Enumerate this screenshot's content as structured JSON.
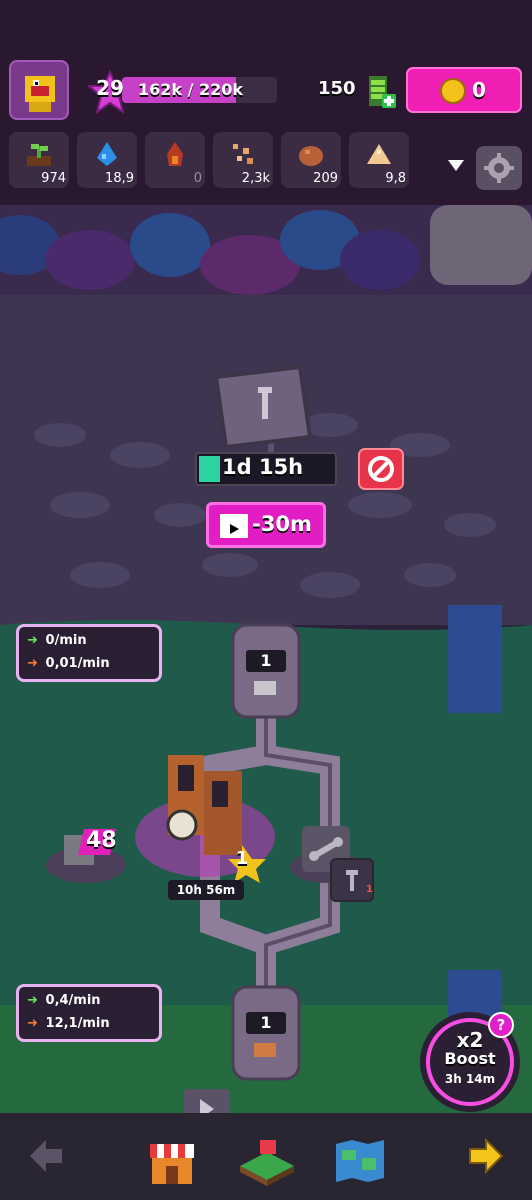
{
  "hud": {
    "player_level": "29",
    "xp_text": "162k / 220k",
    "xp_fraction": 0.736,
    "energy": "150",
    "gold": "0",
    "resources": [
      {
        "icon": "sapling-icon",
        "value": "974",
        "dim": false
      },
      {
        "icon": "water-drop-icon",
        "value": "18,9",
        "dim": false
      },
      {
        "icon": "fire-icon",
        "value": "0",
        "dim": true
      },
      {
        "icon": "sand-particles-icon",
        "value": "2,3k",
        "dim": false
      },
      {
        "icon": "clay-ball-icon",
        "value": "209",
        "dim": false
      },
      {
        "icon": "sand-pile-icon",
        "value": "9,8",
        "dim": false
      }
    ]
  },
  "construction": {
    "timer": "1d 15h",
    "timer_progress": 0.16,
    "video_label": "-30m"
  },
  "rates": {
    "top": {
      "in": "0/min",
      "out": "0,01/min"
    },
    "bottom": {
      "in": "0,4/min",
      "out": "12,1/min"
    }
  },
  "stacks": {
    "top_count": "1",
    "bottom_count": "1"
  },
  "machine": {
    "timer": "10h 56m",
    "level": "1",
    "pink_count": "48",
    "bolt_count": "1"
  },
  "boost": {
    "multiplier": "x2",
    "label": "Boost",
    "time": "3h 14m",
    "help": "?"
  },
  "colors": {
    "accent": "#e21dc4",
    "progress": "#2bd4a0",
    "cancel": "#e8344a",
    "coin": "#f4c21c"
  }
}
